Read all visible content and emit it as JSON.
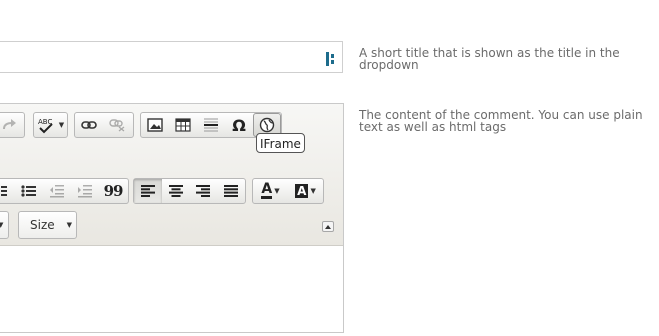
{
  "fields": {
    "title": {
      "value": "",
      "help": "A short title that is shown as the title in the dropdown"
    },
    "content": {
      "help": "The content of the comment. You can use plain text as well as html tags"
    }
  },
  "editor": {
    "toolbar_row1": [
      {
        "group": "spellcheck",
        "items": [
          "spellcheck-icon"
        ]
      },
      {
        "group": "links",
        "items": [
          "link-icon",
          "unlink-icon"
        ]
      },
      {
        "group": "insert",
        "items": [
          "image-icon",
          "table-icon",
          "horizontal-line-icon",
          "omega-icon",
          "iframe-icon"
        ]
      }
    ],
    "toolbar_row2": [
      {
        "group": "lists",
        "items": [
          "bulleted-list-icon",
          "decrease-indent-icon",
          "increase-indent-icon",
          "blockquote-icon"
        ]
      },
      {
        "group": "align",
        "items": [
          "align-left-icon",
          "align-center-icon",
          "align-right-icon",
          "justify-icon"
        ]
      },
      {
        "group": "colors",
        "items": [
          "text-color-icon",
          "background-color-icon"
        ]
      }
    ],
    "size_combo_label": "Size",
    "tooltip": "IFrame",
    "align_left_pressed": true,
    "omega_glyph": "Ω",
    "blockquote_glyph": "99",
    "text_color_glyph": "A",
    "bg_color_glyph": "A",
    "spell_label": "ABC"
  }
}
